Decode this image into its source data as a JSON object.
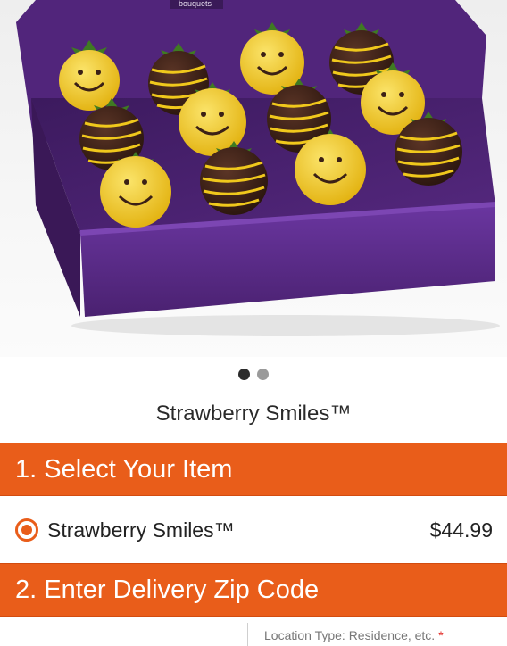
{
  "hero": {
    "box_brand_text": "bouquets"
  },
  "carousel": {
    "slides": 2,
    "active_index": 0
  },
  "product": {
    "title": "Strawberry Smiles™"
  },
  "steps": {
    "step1_label": "1. Select Your Item",
    "step2_label": "2. Enter Delivery Zip Code"
  },
  "items": [
    {
      "name": "Strawberry Smiles™",
      "price": "$44.99",
      "selected": true
    }
  ],
  "delivery": {
    "location_type_label": "Location Type: Residence, etc.",
    "required_mark": "*"
  },
  "colors": {
    "accent": "#e95d1a",
    "box_purple": "#5a2a86",
    "yellow_coating": "#f2cc1c",
    "chocolate": "#3b2016"
  }
}
